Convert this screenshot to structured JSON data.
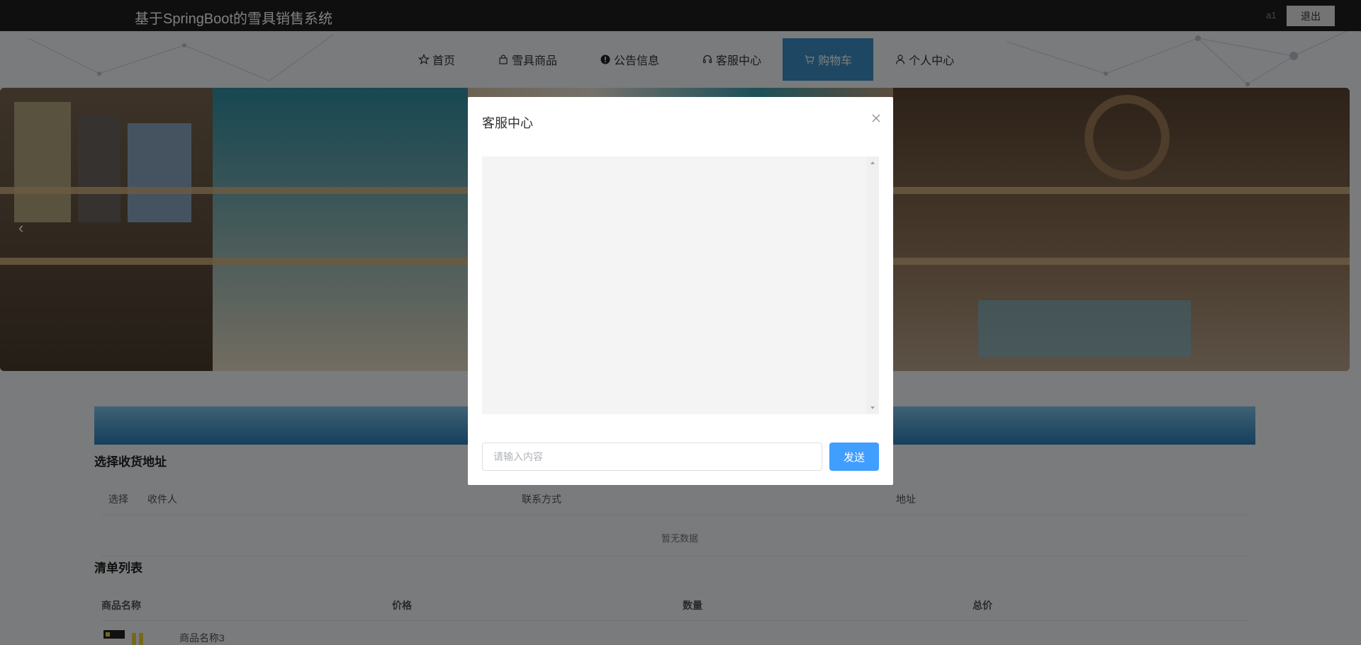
{
  "header": {
    "title": "基于SpringBoot的雪具销售系统",
    "username": "a1",
    "logout_label": "退出"
  },
  "nav": {
    "items": [
      {
        "label": "首页",
        "icon": "star-icon"
      },
      {
        "label": "雪具商品",
        "icon": "bag-icon"
      },
      {
        "label": "公告信息",
        "icon": "alert-icon"
      },
      {
        "label": "客服中心",
        "icon": "headset-icon"
      },
      {
        "label": "购物车",
        "icon": "cart-icon",
        "active": true
      },
      {
        "label": "个人中心",
        "icon": "user-icon"
      }
    ]
  },
  "address_section": {
    "title": "选择收货地址",
    "columns": [
      "选择",
      "收件人",
      "联系方式",
      "地址"
    ],
    "empty_text": "暂无数据"
  },
  "list_section": {
    "title": "清单列表",
    "columns": [
      "商品名称",
      "价格",
      "数量",
      "总价"
    ],
    "rows": [
      {
        "name": "商品名称3"
      }
    ]
  },
  "dialog": {
    "title": "客服中心",
    "input_placeholder": "请输入内容",
    "send_label": "发送"
  },
  "colors": {
    "topbar": "#1f1f1f",
    "nav_active": "#3a8fc4",
    "send_button": "#409eff"
  }
}
